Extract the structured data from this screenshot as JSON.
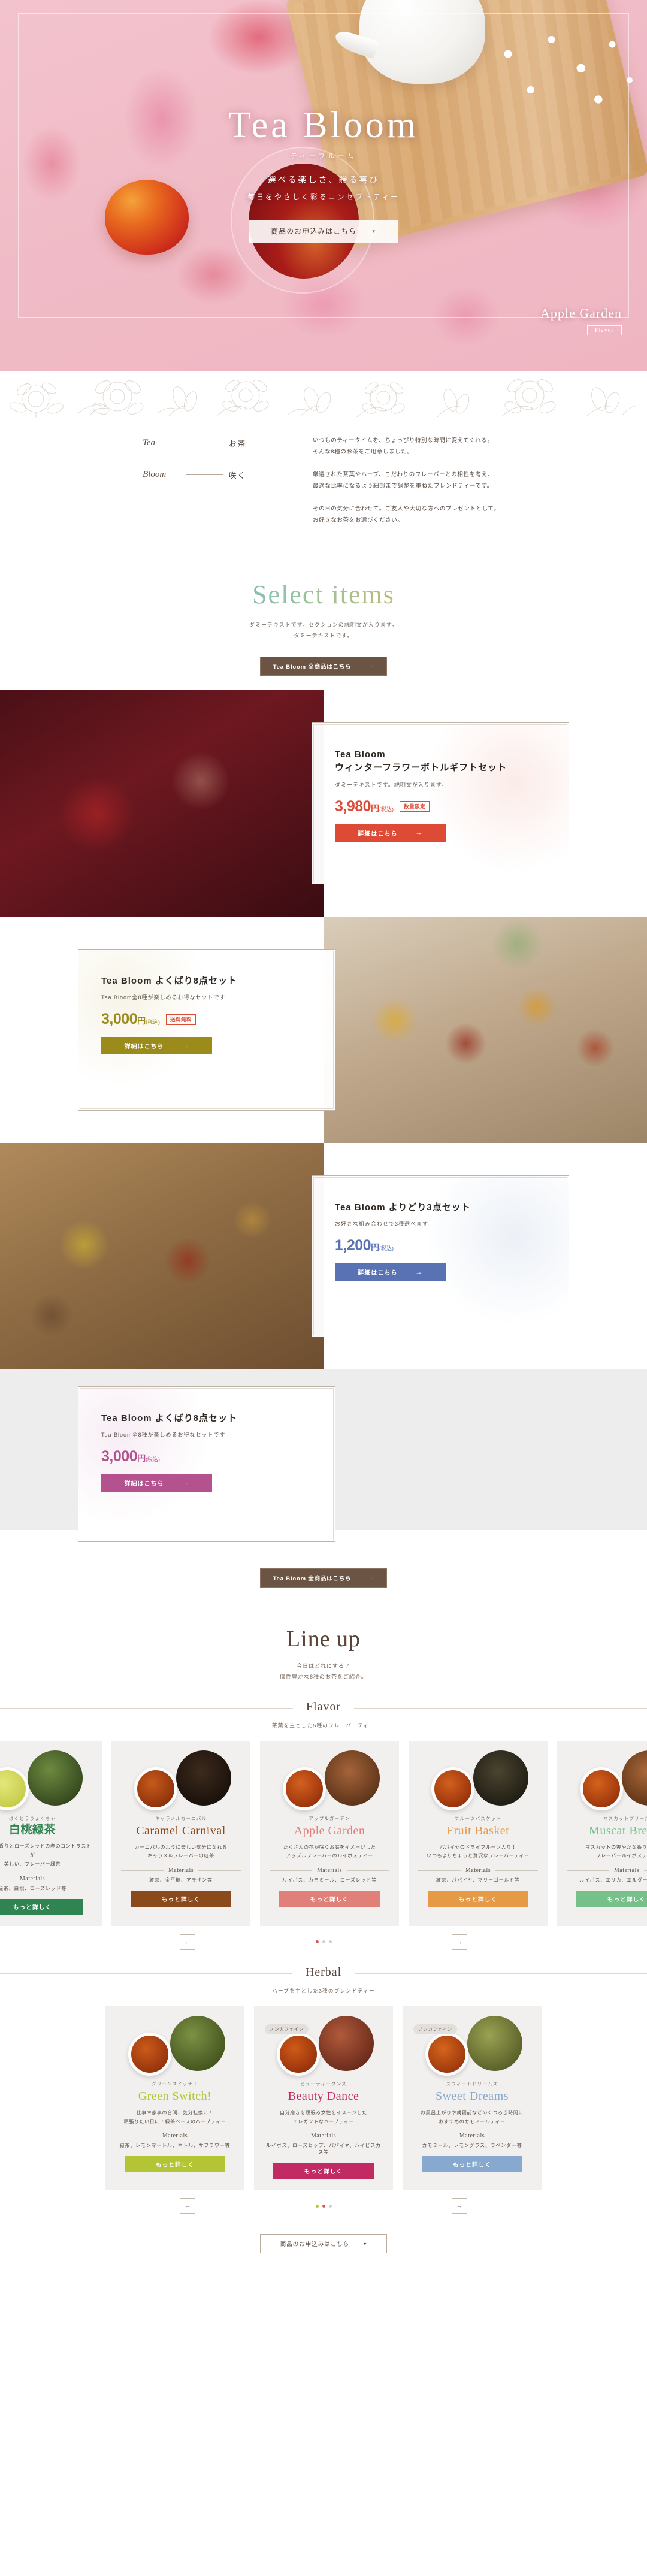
{
  "hero": {
    "title": "Tea Bloom",
    "kana": "ティーブルーム",
    "lead1": "選べる楽しさ、贈る喜び",
    "lead2": "毎日をやさしく彩るコンセプトティー",
    "cta_label": "商品のお申込みはこちら",
    "cta_icon": "chevron-down-icon",
    "brand_name": "Apple Garden",
    "brand_tag": "Flavor"
  },
  "intro": {
    "terms": [
      {
        "en": "Tea",
        "jp": "お茶"
      },
      {
        "en": "Bloom",
        "jp": "咲く"
      }
    ],
    "paragraphs": [
      "いつものティータイムを、ちょっぴり特別な時間に変えてくれる。\nそんな8種のお茶をご用意しました。",
      "厳選された茶葉やハーブ、こだわりのフレーバーとの相性を考え、\n最適な比率になるよう細部まで調整を重ねたブレンドティーです。",
      "その日の気分に合わせて。ご友人や大切な方へのプレゼントとして。\nお好きなお茶をお選びください。"
    ]
  },
  "select_section": {
    "title": "Select items",
    "sub": "ダミーテキストです。セクションの説明文が入ります。\nダミーテキストです。",
    "button": {
      "label": "Tea Bloom 全商品はこちら",
      "icon": "arrow-right-icon"
    }
  },
  "products": [
    {
      "title": "Tea Bloom\nウィンターフラワーボトルギフトセット",
      "desc": "ダミーテキストです。説明文が入ります。",
      "price": "3,980",
      "yen": "円",
      "tax": "(税込)",
      "badge": "数量限定",
      "button_label": "詳細はこちら",
      "button_icon": "arrow-right-icon",
      "accent": "#dd4a35",
      "petal": "#f7d8d2"
    },
    {
      "title": "Tea Bloom よくばり8点セット",
      "desc": "Tea Bloom全8種が楽しめるお得なセットです",
      "price": "3,000",
      "yen": "円",
      "tax": "(税込)",
      "badge": "送料無料",
      "button_label": "詳細はこちら",
      "button_icon": "arrow-right-icon",
      "accent": "#9a8b1b",
      "petal": "#eee9cf"
    },
    {
      "title": "Tea Bloom よりどり3点セット",
      "desc": "お好きな組み合わせで3種選べます",
      "price": "1,200",
      "yen": "円",
      "tax": "(税込)",
      "badge": "",
      "button_label": "詳細はこちら",
      "button_icon": "arrow-right-icon",
      "accent": "#5872b4",
      "petal": "#d9e2ee"
    },
    {
      "title": "Tea Bloom よくばり8点セット",
      "desc": "Tea Bloom全8種が楽しめるお得なセットです",
      "price": "3,000",
      "yen": "円",
      "tax": "(税込)",
      "badge": "",
      "button_label": "詳細はこちら",
      "button_icon": "arrow-right-icon",
      "accent": "#b4518f",
      "petal": "#f0dcea"
    }
  ],
  "select_footer_button": {
    "label": "Tea Bloom 全商品はこちら",
    "icon": "arrow-right-icon"
  },
  "lineup_section": {
    "title": "Line up",
    "sub": "今日はどれにする？\n個性豊かな8種のお茶をご紹介。"
  },
  "flavor_category": {
    "name": "Flavor",
    "sub": "茶葉を主とした5種のフレーバーティー"
  },
  "herbal_category": {
    "name": "Herbal",
    "sub": "ハーブを主とした3種のブレンドティー"
  },
  "flavor_teas": [
    {
      "kana": "はくとうりょくちゃ",
      "name": "白桃緑茶",
      "name_is_jp": true,
      "desc": "白桃の甘い香りとローズレッドの赤のコントラストが\n美しい、フレーバー緑茶",
      "materials_label": "Materials",
      "materials": "緑茶、白桃、ローズレッド等",
      "button_label": "もっと詳しく",
      "color": "#2f8452",
      "leaf": "#3f5a2c",
      "cup": "#c9cf55",
      "badge": ""
    },
    {
      "kana": "キャラメルカーニバル",
      "name": "Caramel Carnival",
      "name_is_jp": false,
      "desc": "カーニバルのように楽しい気分になれる\nキャラメルフレーバーの紅茶",
      "materials_label": "Materials",
      "materials": "紅茶、金平糖、アラザン等",
      "button_label": "もっと詳しく",
      "color": "#8a4a1c",
      "leaf": "#241711",
      "cup": "#9d3d10",
      "badge": ""
    },
    {
      "kana": "アップルガーデン",
      "name": "Apple Garden",
      "name_is_jp": false,
      "desc": "たくさんの花が咲くお庭をイメージした\nアップルフレーバーのルイボスティー",
      "materials_label": "Materials",
      "materials": "ルイボス、カモミール、ローズレッド等",
      "button_label": "もっと詳しく",
      "color": "#e08079",
      "leaf": "#7c4327",
      "cup": "#b03c0e",
      "badge": ""
    },
    {
      "kana": "フルーツバスケット",
      "name": "Fruit Basket",
      "name_is_jp": false,
      "desc": "パパイヤのドライフルーツ入り！\nいつもよりちょっと贅沢なフレーバーティー",
      "materials_label": "Materials",
      "materials": "紅茶、パパイヤ、マリーゴールド等",
      "button_label": "もっと詳しく",
      "color": "#e79a45",
      "leaf": "#2d2a1e",
      "cup": "#ae3c0d",
      "badge": ""
    },
    {
      "kana": "マスカットブリーズ",
      "name": "Muscat Breeze",
      "name_is_jp": false,
      "desc": "マスカットの爽やかな香りが広がる\nフレーバールイボスティー",
      "materials_label": "Materials",
      "materials": "ルイボス、エリカ、エルダーフラワー等",
      "button_label": "もっと詳しく",
      "color": "#77c08a",
      "leaf": "#7a4a28",
      "cup": "#b03f0d",
      "badge": ""
    }
  ],
  "herbal_teas": [
    {
      "kana": "グリーンスイッチ！",
      "name": "Green Switch!",
      "name_is_jp": false,
      "desc": "仕事や家事の合間、気分転換に！\n頑張りたい日に！緑茶ベースのハーブティー",
      "materials_label": "Materials",
      "materials": "緑茶、レモンマートル、ネトル、サフラワー等",
      "button_label": "もっと詳しく",
      "color": "#b3c434",
      "leaf": "#4e6327",
      "cup": "#a83d12",
      "badge": ""
    },
    {
      "kana": "ビューティーダンス",
      "name": "Beauty Dance",
      "name_is_jp": false,
      "desc": "自分磨きを頑張る女性をイメージした\nエレガントなハーブティー",
      "materials_label": "Materials",
      "materials": "ルイボス、ローズヒップ、パパイヤ、ハイビスカス等",
      "button_label": "もっと詳しく",
      "color": "#c22a63",
      "leaf": "#8b3a2a",
      "cup": "#ad3a10",
      "badge": "ノンカフェイン"
    },
    {
      "kana": "スウィートドリームス",
      "name": "Sweet Dreams",
      "name_is_jp": false,
      "desc": "お風呂上がりや就寝前などのくつろぎ時間に\nおすすめのカモミールティー",
      "materials_label": "Materials",
      "materials": "カモミール、レモングラス、ラベンダー等",
      "button_label": "もっと詳しく",
      "color": "#87a9cf",
      "leaf": "#6e7a3a",
      "cup": "#b24511",
      "badge": "ノンカフェイン"
    }
  ],
  "carousel": {
    "prev_icon": "arrow-left-icon",
    "next_icon": "arrow-right-icon"
  },
  "footer_button": {
    "label": "商品のお申込みはこちら",
    "icon": "chevron-down-icon"
  }
}
